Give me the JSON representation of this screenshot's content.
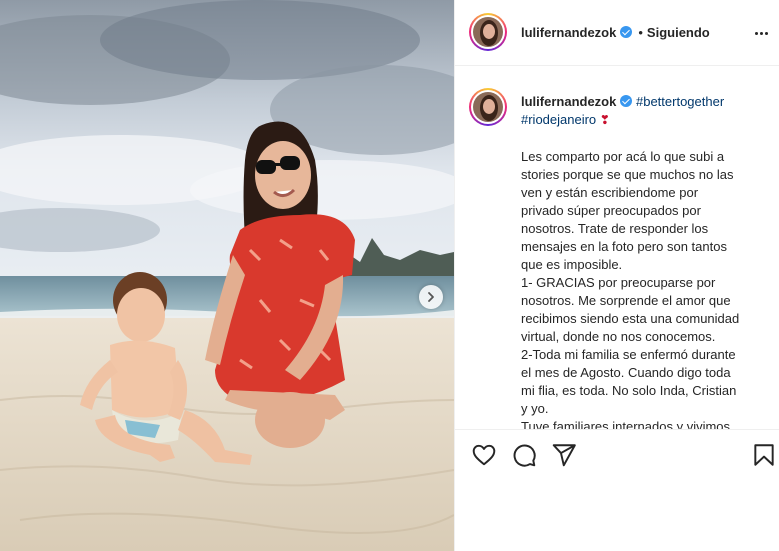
{
  "post": {
    "username": "lulifernandezok",
    "follow_status": "Siguiendo",
    "separator": "•",
    "hashtag_1": "#bettertogether",
    "hashtag_2": "#riodejaneiro",
    "heart_emoji": "❣",
    "caption_lines": [
      "Les comparto por acá lo que subi a",
      "stories porque se que muchos no las",
      "ven y están escribiendome por",
      "privado súper preocupados por",
      "nosotros. Trate de responder los",
      "mensajes en la foto pero son tantos",
      "que es imposible.",
      "1- GRACIAS por preocuparse por",
      "nosotros. Me sorprende el amor que",
      "recibimos siendo esta una comunidad",
      "virtual, donde no nos conocemos.",
      "2-Toda mi familia se enfermó durante",
      "el mes de Agosto. Cuando digo toda",
      "mi flia, es toda. No solo Inda, Cristian",
      "y yo.",
      "Tuve familiares internados y vivimos"
    ]
  },
  "icons": {
    "more": "more-options-icon",
    "next": "chevron-right-icon",
    "like": "heart-icon",
    "comment": "comment-icon",
    "share": "send-icon",
    "save": "bookmark-icon",
    "verified": "verified-badge-icon"
  },
  "colors": {
    "hashtag": "#00376b",
    "verified": "#3897f0",
    "border": "#efefef"
  }
}
